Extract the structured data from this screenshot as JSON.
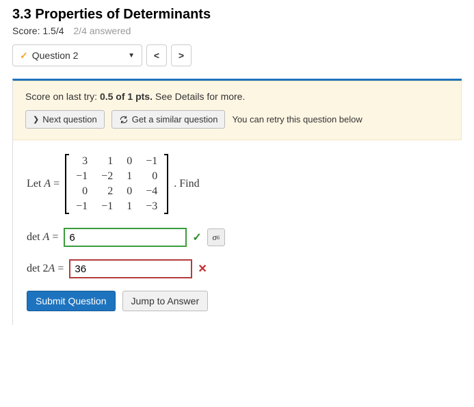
{
  "header": {
    "title": "3.3 Properties of Determinants",
    "score_label": "Score: 1.5/4",
    "answered_label": "2/4 answered"
  },
  "nav": {
    "question_label": "Question 2",
    "prev": "<",
    "next": ">"
  },
  "feedback": {
    "line_prefix": "Score on last try: ",
    "line_bold": "0.5 of 1 pts.",
    "line_suffix": " See Details for more.",
    "next_question": "Next question",
    "similar": "Get a similar question",
    "retry": "You can retry this question below"
  },
  "question": {
    "let_label": "Let ",
    "A_sym": "A",
    "equals": " = ",
    "matrix": [
      [
        "3",
        "1",
        "0",
        "−1"
      ],
      [
        "−1",
        "−2",
        "1",
        "0"
      ],
      [
        "0",
        "2",
        "0",
        "−4"
      ],
      [
        "−1",
        "−1",
        "1",
        "−3"
      ]
    ],
    "find_label": ". Find",
    "detA_label_pre": "det ",
    "detA_label_var": "A",
    "det2A_label_pre": "det ",
    "det2A_label_mid": "2",
    "det2A_label_var": "A",
    "eq": " = ",
    "answers": {
      "detA": {
        "value": "6",
        "status": "correct"
      },
      "det2A": {
        "value": "36",
        "status": "wrong"
      }
    }
  },
  "buttons": {
    "submit": "Submit Question",
    "jump": "Jump to Answer",
    "keypad": "σ"
  },
  "icons": {
    "check": "✓",
    "cross": "✕",
    "chevron_right": "❯",
    "caret_down": "▼"
  }
}
